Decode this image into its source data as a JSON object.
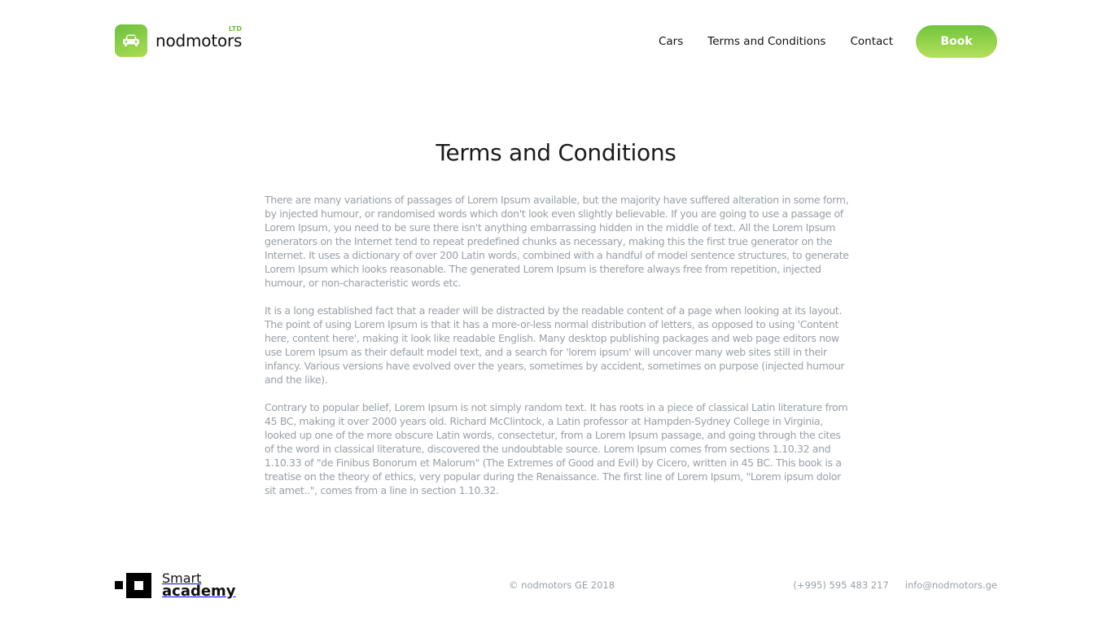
{
  "header": {
    "logo_text": "nodmotors",
    "logo_suffix": "LTD",
    "logo_icon": "car-icon",
    "nav": [
      "Cars",
      "Terms and Conditions",
      "Contact"
    ],
    "book_label": "Book"
  },
  "main": {
    "title": "Terms and Conditions",
    "paragraphs": [
      "There are many variations of passages of Lorem Ipsum available, but the majority have suffered alteration in some form, by injected humour, or randomised words which don't look even slightly believable. If you are going to use a passage of Lorem Ipsum, you need to be sure there isn't anything embarrassing hidden in the middle of text. All the Lorem Ipsum generators on the Internet tend to repeat predefined chunks as necessary, making this the first true generator on the Internet. It uses a dictionary of over 200 Latin words, combined with a handful of model sentence structures, to generate Lorem Ipsum which looks reasonable. The generated Lorem Ipsum is therefore always free from repetition, injected humour, or non-characteristic words etc.",
      "It is a long established fact that a reader will be distracted by the readable content of a page when looking at its layout. The point of using Lorem Ipsum is that it has a more-or-less normal distribution of letters, as opposed to using 'Content here, content here', making it look like readable English. Many desktop publishing packages and web page editors now use Lorem Ipsum as their default model text, and a search for 'lorem ipsum' will uncover many web sites still in their infancy. Various versions have evolved over the years, sometimes by accident, sometimes on purpose (injected humour and the like).",
      "Contrary to popular belief, Lorem Ipsum is not simply random text. It has roots in a piece of classical Latin literature from 45 BC, making it over 2000 years old. Richard McClintock, a Latin professor at Hampden-Sydney College in Virginia, looked up one of the more obscure Latin words, consectetur, from a Lorem Ipsum passage, and going through the cites of the word in classical literature, discovered the undoubtable source. Lorem Ipsum comes from sections 1.10.32 and 1.10.33 of \"de Finibus Bonorum et Malorum\" (The Extremes of Good and Evil) by Cicero, written in 45 BC. This book is a treatise on the theory of ethics, very popular during the Renaissance. The first line of Lorem Ipsum, \"Lorem ipsum dolor sit amet..\", comes from a line in section 1.10.32."
    ]
  },
  "footer": {
    "brand_line1": "Smart",
    "brand_line2": "academy",
    "copyright": "© nodmotors GE 2018",
    "phone": "(+995) 595 483 217",
    "email": "info@nodmotors.ge"
  },
  "colors": {
    "accent": "#7cc742",
    "body_text": "#9aa0a6",
    "heading": "#1a1a1a"
  }
}
